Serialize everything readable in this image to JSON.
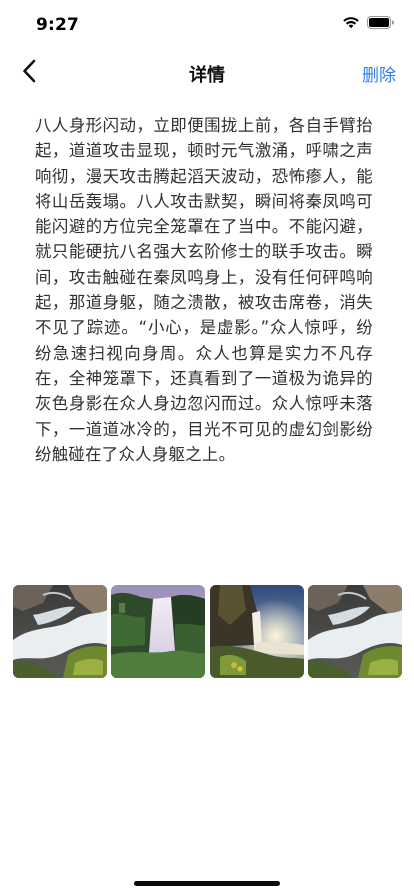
{
  "status_bar": {
    "time": "9:27",
    "icons": [
      "wifi-icon",
      "battery-icon"
    ]
  },
  "nav": {
    "back_icon": "chevron-left-icon",
    "title": "详情",
    "delete_label": "删除",
    "accent_color": "#2f7ee8"
  },
  "content": {
    "text": "八人身形闪动，立即便围拢上前，各自手臂抬起，道道攻击显现，顿时元气激涌，呼啸之声响彻，漫天攻击腾起滔天波动，恐怖瘆人，能将山岳轰塌。八人攻击默契，瞬间将秦凤鸣可能闪避的方位完全笼罩在了当中。不能闪避，就只能硬抗八名强大玄阶修士的联手攻击。瞬间，攻击触碰在秦凤鸣身上，没有任何砰鸣响起，那道身躯，随之溃散，被攻击席卷，消失不见了踪迹。“小心，是虚影。”众人惊呼，纷纷急速扫视向身周。众人也算是实力不凡存在，全神笼罩下，还真看到了一道极为诡异的灰色身影在众人身边忽闪而过。众人惊呼未落下，一道道冰冷的，目光不可见的虚幻剑影纷纷触碰在了众人身躯之上。"
  },
  "gallery": {
    "images": [
      "waterfall-rocks-image",
      "skogafoss-waterfall-image",
      "waterfall-sunset-image",
      "waterfall-rocks-image"
    ]
  }
}
